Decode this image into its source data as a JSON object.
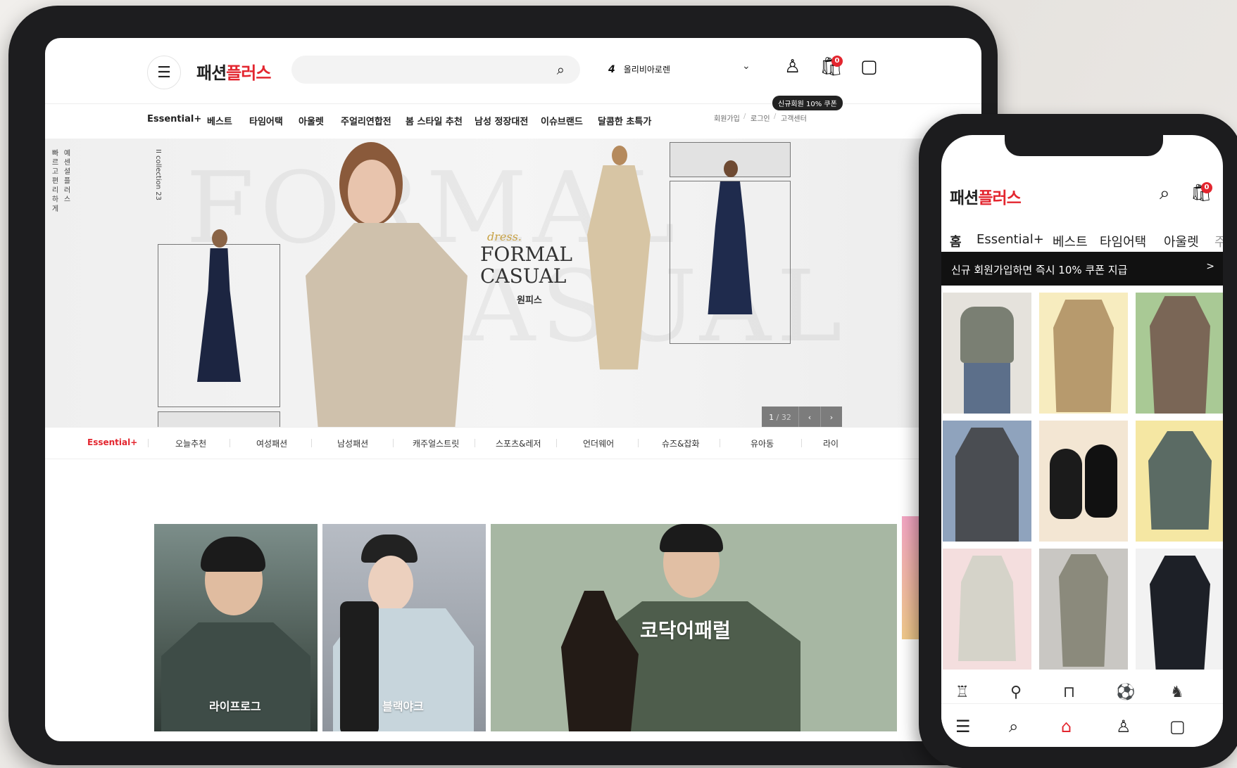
{
  "tablet": {
    "logo_dark": "패션",
    "logo_red": "플러스",
    "menu_icon": "☰",
    "search_icon": "⌕",
    "rank_num": "4",
    "rank_text": "올리비아로렌",
    "rank_arrow": "⌄",
    "user_icon": "♙",
    "cart_icon": "🛍",
    "cart_count": "0",
    "recent_icon": "▢",
    "nav": [
      "Essential+",
      "베스트",
      "타임어택",
      "아울렛",
      "주얼리연합전",
      "봄 스타일 추천",
      "남성 정장대전",
      "이슈브랜드",
      "달콤한 초특가"
    ],
    "coupon_tip": "신규회원 10% 쿠폰",
    "util": [
      "회원가입",
      "로그인",
      "고객센터"
    ],
    "util_sep": "/",
    "hero": {
      "side_text_1": "예 센 셜 플 러 스",
      "side_text_2": "빠 르 고 편 리 하 게",
      "collection": "II collection 23",
      "bg_text_1": "FORMAL",
      "bg_text_2": "CASUAL",
      "script": "dress.",
      "title_1": "FORMAL",
      "title_2": "CASUAL",
      "kr": "원피스",
      "pager_current": "1",
      "pager_total": "/ 32",
      "pager_prev": "‹",
      "pager_next": "›"
    },
    "categories": [
      "Essential+",
      "오늘추천",
      "여성패션",
      "남성패션",
      "캐주얼스트릿",
      "스포츠&레저",
      "언더웨어",
      "슈즈&잡화",
      "유아동",
      "라이"
    ],
    "tiles": [
      "라이프로그",
      "블랙야크",
      "코닥어패럴"
    ]
  },
  "phone": {
    "logo_dark": "패션",
    "logo_red": "플러스",
    "search_icon": "⌕",
    "cart_icon": "🛍",
    "cart_count": "0",
    "nav": [
      "홈",
      "Essential+",
      "베스트",
      "타임어택",
      "아울렛",
      "주"
    ],
    "banner": "신규 회원가입하면 즉시 10% 쿠폰 지급",
    "banner_arrow": ">",
    "cat_icons": [
      "♖",
      "⚲",
      "⊓",
      "⚽",
      "♞"
    ],
    "tabbar": [
      "☰",
      "⌕",
      "⌂",
      "♙",
      "▢"
    ]
  },
  "colors": {
    "accent": "#e3262f",
    "dark": "#111111"
  }
}
